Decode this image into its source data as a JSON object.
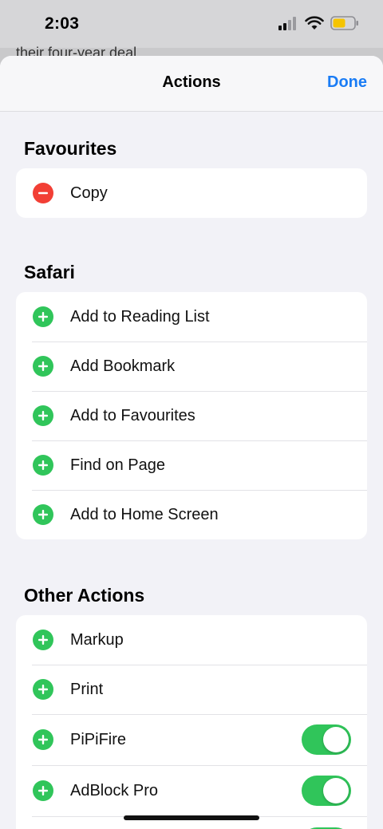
{
  "status_bar": {
    "time": "2:03"
  },
  "background": {
    "text": "their four-year deal"
  },
  "nav": {
    "title": "Actions",
    "done_label": "Done"
  },
  "colors": {
    "accent": "#1a7cf5",
    "add": "#30c55a",
    "remove": "#f23f35"
  },
  "sections": {
    "favourites": {
      "title": "Favourites",
      "items": [
        {
          "label": "Copy",
          "icon": "remove-circle-icon"
        }
      ]
    },
    "safari": {
      "title": "Safari",
      "items": [
        {
          "label": "Add to Reading List",
          "icon": "add-circle-icon"
        },
        {
          "label": "Add Bookmark",
          "icon": "add-circle-icon"
        },
        {
          "label": "Add to Favourites",
          "icon": "add-circle-icon"
        },
        {
          "label": "Find on Page",
          "icon": "add-circle-icon"
        },
        {
          "label": "Add to Home Screen",
          "icon": "add-circle-icon"
        }
      ]
    },
    "other_actions": {
      "title": "Other Actions",
      "items": [
        {
          "label": "Markup",
          "icon": "add-circle-icon"
        },
        {
          "label": "Print",
          "icon": "add-circle-icon"
        },
        {
          "label": "PiPiFire",
          "icon": "add-circle-icon",
          "toggle": "on"
        },
        {
          "label": "AdBlock Pro",
          "icon": "add-circle-icon",
          "toggle": "on"
        }
      ]
    }
  }
}
